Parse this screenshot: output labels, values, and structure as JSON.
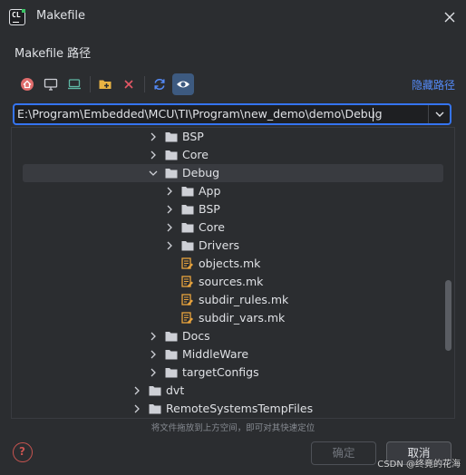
{
  "window": {
    "title": "Makefile",
    "logo_text": "CL"
  },
  "section_label": "Makefile 路径",
  "toolbar": {
    "buttons": [
      {
        "icon": "home-icon"
      },
      {
        "icon": "desktop-icon"
      },
      {
        "icon": "project-icon"
      },
      {
        "icon": "new-folder-icon"
      },
      {
        "icon": "delete-icon"
      },
      {
        "icon": "refresh-icon"
      },
      {
        "icon": "show-hidden-icon",
        "active": true
      }
    ],
    "hide_path_label": "隐藏路径"
  },
  "path_field": {
    "value": "E:\\Program\\Embedded\\MCU\\TI\\Program\\new_demo\\demo\\Debug"
  },
  "tree": {
    "rows": [
      {
        "label": "BSP",
        "type": "folder",
        "expanded": false
      },
      {
        "label": "Core",
        "type": "folder",
        "expanded": false
      },
      {
        "label": "Debug",
        "type": "folder",
        "expanded": true,
        "selected": true
      },
      {
        "label": "App",
        "type": "folder",
        "expanded": false
      },
      {
        "label": "BSP",
        "type": "folder",
        "expanded": false
      },
      {
        "label": "Core",
        "type": "folder",
        "expanded": false
      },
      {
        "label": "Drivers",
        "type": "folder",
        "expanded": false
      },
      {
        "label": "objects.mk",
        "type": "makefile"
      },
      {
        "label": "sources.mk",
        "type": "makefile"
      },
      {
        "label": "subdir_rules.mk",
        "type": "makefile"
      },
      {
        "label": "subdir_vars.mk",
        "type": "makefile"
      },
      {
        "label": "Docs",
        "type": "folder",
        "expanded": false
      },
      {
        "label": "MiddleWare",
        "type": "folder",
        "expanded": false
      },
      {
        "label": "targetConfigs",
        "type": "folder",
        "expanded": false
      },
      {
        "label": "dvt",
        "type": "folder",
        "expanded": false
      },
      {
        "label": "RemoteSystemsTempFiles",
        "type": "folder",
        "expanded": false
      }
    ]
  },
  "hint": "将文件拖放到上方空间，即可对其快速定位",
  "buttons": {
    "ok": "确定",
    "cancel": "取消"
  },
  "watermark": "CSDN @终竟的花海",
  "colors": {
    "background": "#2b2d30",
    "accent": "#3574f0",
    "link": "#548af7",
    "makefile_icon": "#e8a33d",
    "help": "#c75450"
  }
}
